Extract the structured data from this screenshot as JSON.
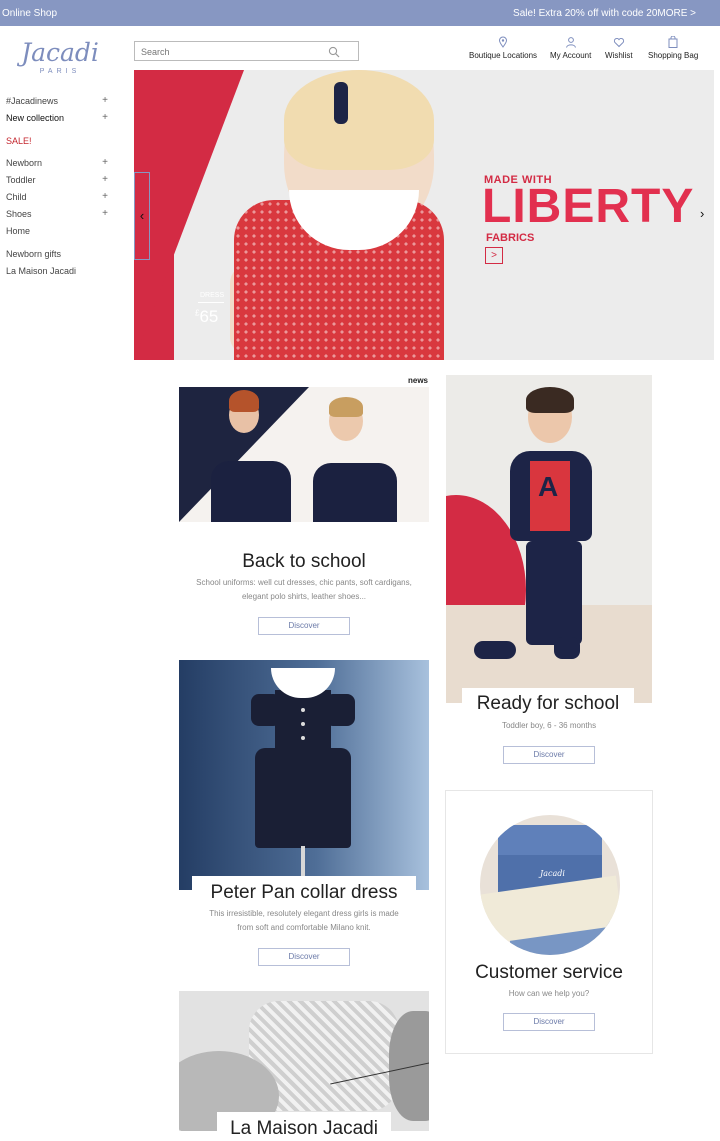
{
  "topbar": {
    "left": "Online Shop",
    "right": "Sale! Extra 20% off with code 20MORE >"
  },
  "logo": {
    "brand": "Jacadi",
    "sub": "PARIS"
  },
  "search": {
    "placeholder": "Search"
  },
  "header_nav": [
    {
      "label": "Boutique Locations",
      "icon": "map-pin-icon"
    },
    {
      "label": "My Account",
      "icon": "user-icon"
    },
    {
      "label": "Wishlist",
      "icon": "heart-icon"
    },
    {
      "label": "Shopping Bag",
      "icon": "shopping-bag-icon"
    }
  ],
  "sidebar": {
    "items": [
      {
        "label": "#Jacadinews",
        "expand": "+"
      },
      {
        "label": "New collection",
        "expand": "+"
      },
      {
        "label": "SALE!"
      },
      {
        "label": "Newborn",
        "expand": "+"
      },
      {
        "label": "Toddler",
        "expand": "+"
      },
      {
        "label": "Child",
        "expand": "+"
      },
      {
        "label": "Shoes",
        "expand": "+"
      },
      {
        "label": "Home"
      },
      {
        "label": "Newborn gifts"
      },
      {
        "label": "La Maison Jacadi"
      }
    ]
  },
  "hero": {
    "made_with": "MADE WITH",
    "headline": "LIBERTY",
    "fabrics": "FABRICS",
    "go": ">",
    "price_label": "DRESS",
    "price_currency": "£",
    "price_value": "65",
    "prev": "‹",
    "next": "›"
  },
  "tiles": {
    "news_tag": "news",
    "back_to_school": {
      "title": "Back to school",
      "desc_line1": "School uniforms: well cut dresses, chic pants, soft cardigans,",
      "desc_line2": "elegant polo shirts, leather shoes...",
      "cta": "Discover"
    },
    "ready_for_school": {
      "title": "Ready for school",
      "desc": "Toddler boy, 6 - 36 months",
      "cta": "Discover"
    },
    "peter_pan": {
      "title": "Peter Pan collar dress",
      "desc_line1": "This irresistible, resolutely elegant dress girls is made",
      "desc_line2": "from soft and comfortable Milano knit.",
      "cta": "Discover"
    },
    "customer_service": {
      "title": "Customer service",
      "desc": "How can we help you?",
      "cta": "Discover",
      "box_mark": "Jacadi"
    },
    "la_maison": {
      "title": "La Maison Jacadi"
    }
  },
  "colors": {
    "accent": "#8797c2",
    "sale_red": "#c4262e",
    "liberty_red": "#e2304f"
  }
}
